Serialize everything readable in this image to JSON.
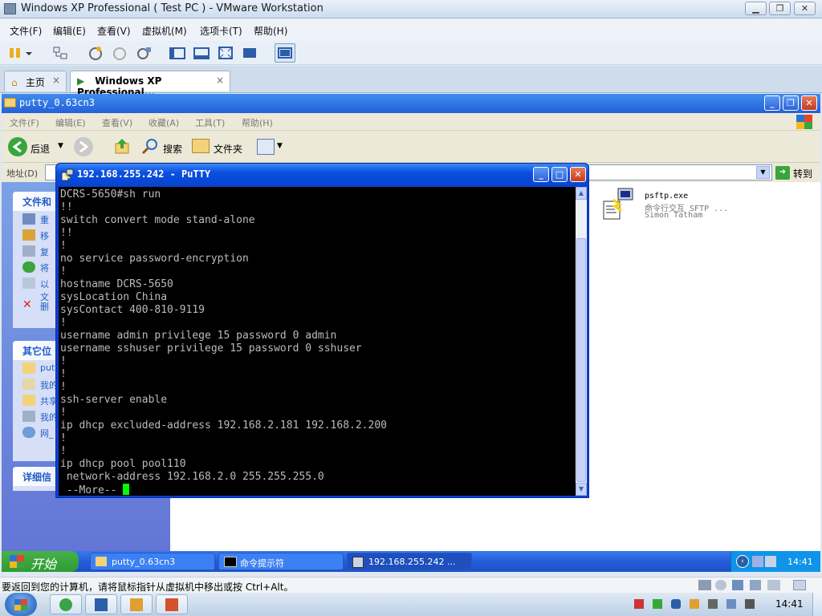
{
  "vm_window": {
    "title": "Windows XP Professional ( Test PC ) - VMware Workstation",
    "menus": [
      "文件(F)",
      "编辑(E)",
      "查看(V)",
      "虚拟机(M)",
      "选项卡(T)",
      "帮助(H)"
    ],
    "tabs": [
      {
        "label": "主页",
        "close": "×"
      },
      {
        "label": "Windows XP Professional...",
        "close": "×"
      }
    ],
    "status_text": "要返回到您的计算机，请将鼠标指针从虚拟机中移出或按 Ctrl+Alt。"
  },
  "explorer": {
    "title": "putty_0.63cn3",
    "menus": [
      "文件(F)",
      "编辑(E)",
      "查看(V)",
      "收藏(A)",
      "工具(T)",
      "帮助(H)"
    ],
    "toolbar": {
      "back": "后退",
      "search": "搜索",
      "folders": "文件夹"
    },
    "address_label": "地址(D)",
    "go_label": "转到",
    "taskpane": {
      "file_tasks_title": "文件和",
      "file_tasks": [
        "重",
        "移",
        "复",
        "将",
        "以",
        "文",
        "删"
      ],
      "other_title": "其它位",
      "other_places": [
        "put",
        "我的",
        "共享",
        "我的",
        "网_"
      ],
      "details_title": "详细信"
    },
    "file": {
      "name": "psftp.exe",
      "desc": "命令行交互 SFTP ...",
      "author": "Simon Tatham"
    }
  },
  "putty": {
    "title": "192.168.255.242 - PuTTY",
    "terminal_lines": [
      "DCRS-5650#sh run",
      "!!",
      "switch convert mode stand-alone",
      "!!",
      "!",
      "no service password-encryption",
      "!",
      "hostname DCRS-5650",
      "sysLocation China",
      "sysContact 400-810-9119",
      "!",
      "username admin privilege 15 password 0 admin",
      "username sshuser privilege 15 password 0 sshuser",
      "!",
      "!",
      "!",
      "ssh-server enable",
      "!",
      "ip dhcp excluded-address 192.168.2.181 192.168.2.200",
      "!",
      "!",
      "ip dhcp pool pool110",
      " network-address 192.168.2.0 255.255.255.0"
    ],
    "more_prompt": " --More-- "
  },
  "xp_taskbar": {
    "start": "开始",
    "tasks": [
      "putty_0.63cn3",
      "命令提示符",
      "192.168.255.242 ..."
    ],
    "clock": "14:41"
  },
  "w7_taskbar": {
    "clock": "14:41"
  }
}
